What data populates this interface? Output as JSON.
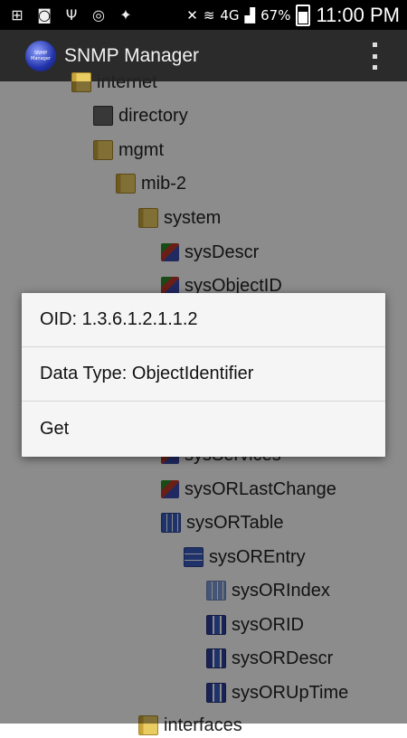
{
  "status_bar": {
    "battery": "67%",
    "network": "4G",
    "time": "11:00 PM"
  },
  "action_bar": {
    "logo_text": "SNMP Manager",
    "title": "SNMP Manager"
  },
  "tree": [
    {
      "label": "internet",
      "icon": "folder-icon"
    },
    {
      "label": "directory",
      "icon": "directory-icon"
    },
    {
      "label": "mgmt",
      "icon": "folder-icon"
    },
    {
      "label": "mib-2",
      "icon": "folder-icon"
    },
    {
      "label": "system",
      "icon": "folder-icon"
    },
    {
      "label": "sysDescr",
      "icon": "leaf-icon"
    },
    {
      "label": "sysObjectID",
      "icon": "leaf-icon"
    },
    {
      "label": "sysServices",
      "icon": "leaf-icon"
    },
    {
      "label": "sysORLastChange",
      "icon": "leaf-icon"
    },
    {
      "label": "sysORTable",
      "icon": "table-icon"
    },
    {
      "label": "sysOREntry",
      "icon": "entry-icon"
    },
    {
      "label": "sysORIndex",
      "icon": "index-icon"
    },
    {
      "label": "sysORID",
      "icon": "column-icon"
    },
    {
      "label": "sysORDescr",
      "icon": "column-icon"
    },
    {
      "label": "sysORUpTime",
      "icon": "column-icon"
    },
    {
      "label": "interfaces",
      "icon": "folder-icon"
    }
  ],
  "dialog": {
    "oid": "OID: 1.3.6.1.2.1.1.2",
    "data_type": "Data Type: ObjectIdentifier",
    "action": "Get"
  }
}
